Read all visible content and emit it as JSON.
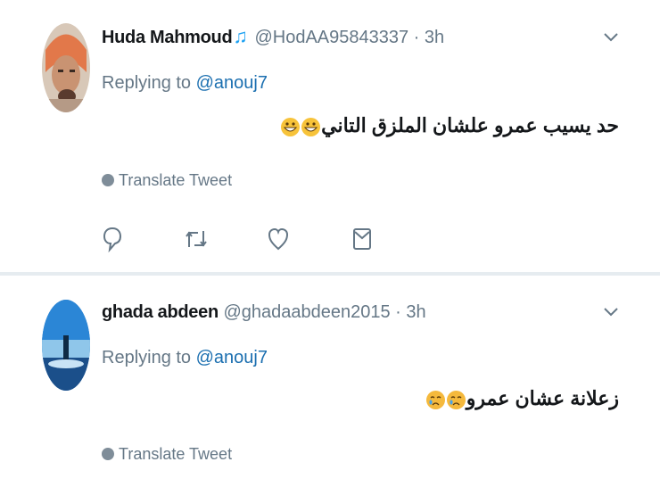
{
  "tweets": [
    {
      "name": "Huda Mahmoud",
      "handle": "@HodAA95843337",
      "separator": "·",
      "time": "3h",
      "replying_prefix": "Replying to",
      "replying_to": "@anouj7",
      "text": "حد يسيب عمرو علشان الملزق التاني",
      "translate": "Translate Tweet",
      "emoji_icons": [
        "grinning-face-icon",
        "grinning-face-icon"
      ]
    },
    {
      "name": "ghada abdeen",
      "handle": "@ghadaabdeen2015",
      "separator": "·",
      "time": "3h",
      "replying_prefix": "Replying to",
      "replying_to": "@anouj7",
      "text": "زعلانة عشان عمرو",
      "translate": "Translate Tweet",
      "emoji_icons": [
        "crying-face-icon",
        "crying-face-icon"
      ]
    }
  ],
  "icons": {
    "verified_music": "music-note-icon",
    "menu": "chevron-down-icon",
    "reply": "reply-icon",
    "retweet": "retweet-icon",
    "like": "heart-icon",
    "message": "direct-message-icon",
    "translate": "globe-icon"
  },
  "colors": {
    "link": "#1b6fb0",
    "muted": "#657786",
    "accent": "#1da1f2",
    "divider": "#e6ecf0"
  }
}
